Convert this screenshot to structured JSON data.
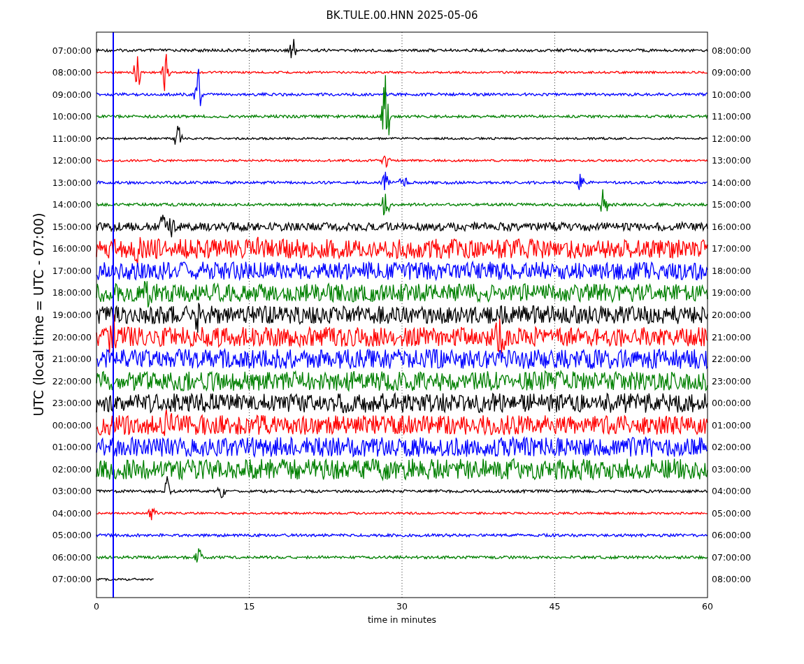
{
  "title": "BK.TULE.00.HNN 2025-05-06",
  "ylabel": "UTC (local time = UTC - 07:00)",
  "xlabel": "time in minutes",
  "xticks": [
    "0",
    "15",
    "30",
    "45",
    "60"
  ],
  "traces": [
    {
      "utc": "07:00:00",
      "local": "08:00:00",
      "color": "#000000"
    },
    {
      "utc": "08:00:00",
      "local": "09:00:00",
      "color": "#ff0000"
    },
    {
      "utc": "09:00:00",
      "local": "10:00:00",
      "color": "#0000ff"
    },
    {
      "utc": "10:00:00",
      "local": "11:00:00",
      "color": "#008000"
    },
    {
      "utc": "11:00:00",
      "local": "12:00:00",
      "color": "#000000"
    },
    {
      "utc": "12:00:00",
      "local": "13:00:00",
      "color": "#ff0000"
    },
    {
      "utc": "13:00:00",
      "local": "14:00:00",
      "color": "#0000ff"
    },
    {
      "utc": "14:00:00",
      "local": "15:00:00",
      "color": "#008000"
    },
    {
      "utc": "15:00:00",
      "local": "16:00:00",
      "color": "#000000"
    },
    {
      "utc": "16:00:00",
      "local": "17:00:00",
      "color": "#ff0000"
    },
    {
      "utc": "17:00:00",
      "local": "18:00:00",
      "color": "#0000ff"
    },
    {
      "utc": "18:00:00",
      "local": "19:00:00",
      "color": "#008000"
    },
    {
      "utc": "19:00:00",
      "local": "20:00:00",
      "color": "#000000"
    },
    {
      "utc": "20:00:00",
      "local": "21:00:00",
      "color": "#ff0000"
    },
    {
      "utc": "21:00:00",
      "local": "22:00:00",
      "color": "#0000ff"
    },
    {
      "utc": "22:00:00",
      "local": "23:00:00",
      "color": "#008000"
    },
    {
      "utc": "23:00:00",
      "local": "00:00:00",
      "color": "#000000"
    },
    {
      "utc": "00:00:00",
      "local": "01:00:00",
      "color": "#ff0000"
    },
    {
      "utc": "01:00:00",
      "local": "02:00:00",
      "color": "#0000ff"
    },
    {
      "utc": "02:00:00",
      "local": "03:00:00",
      "color": "#008000"
    },
    {
      "utc": "03:00:00",
      "local": "04:00:00",
      "color": "#000000"
    },
    {
      "utc": "04:00:00",
      "local": "05:00:00",
      "color": "#ff0000"
    },
    {
      "utc": "05:00:00",
      "local": "06:00:00",
      "color": "#0000ff"
    },
    {
      "utc": "06:00:00",
      "local": "07:00:00",
      "color": "#008000"
    },
    {
      "utc": "07:00:00",
      "local": "08:00:00",
      "color": "#000000"
    }
  ]
}
